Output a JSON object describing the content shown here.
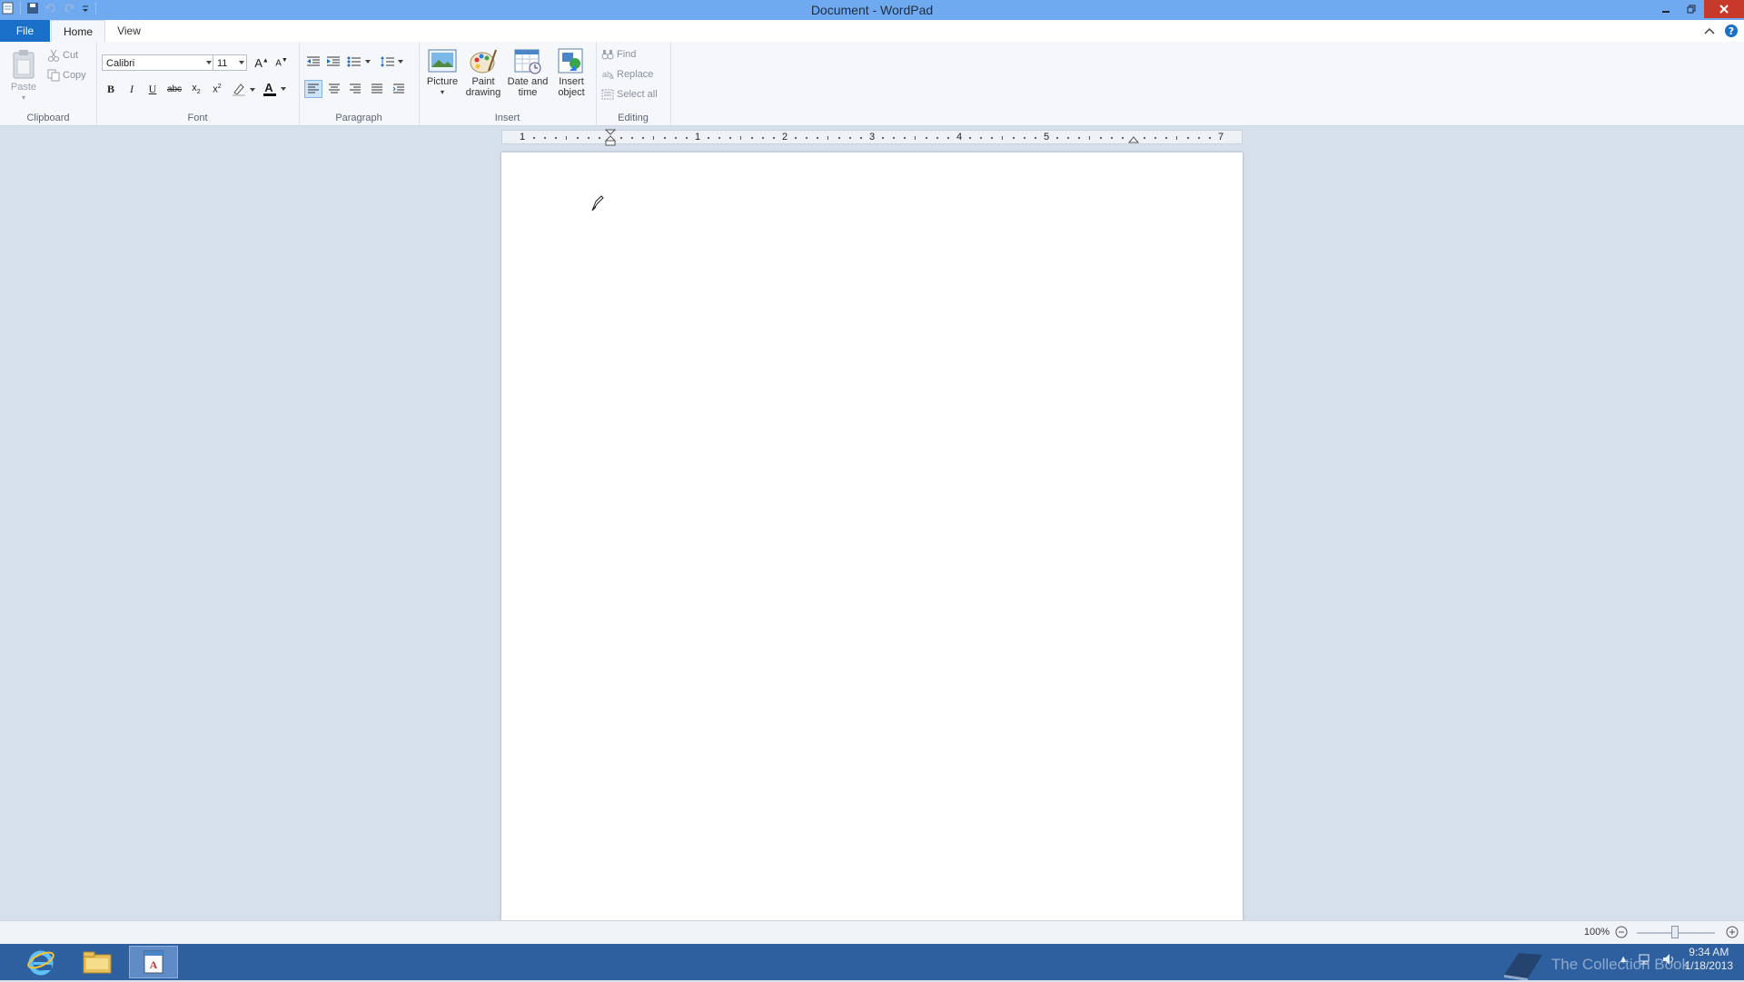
{
  "window": {
    "title": "Document - WordPad"
  },
  "ribbon_tabs": {
    "file": "File",
    "home": "Home",
    "view": "View"
  },
  "clipboard": {
    "paste": "Paste",
    "cut": "Cut",
    "copy": "Copy",
    "group_label": "Clipboard"
  },
  "font": {
    "family": "Calibri",
    "size": "11",
    "group_label": "Font"
  },
  "paragraph": {
    "group_label": "Paragraph"
  },
  "insert": {
    "picture": "Picture",
    "paint_drawing_1": "Paint",
    "paint_drawing_2": "drawing",
    "date_time_1": "Date and",
    "date_time_2": "time",
    "insert_object_1": "Insert",
    "insert_object_2": "object",
    "group_label": "Insert"
  },
  "editing": {
    "find": "Find",
    "replace": "Replace",
    "select_all": "Select all",
    "group_label": "Editing"
  },
  "ruler": {
    "numbers": [
      "1",
      "1",
      "2",
      "3",
      "4",
      "5",
      "7"
    ]
  },
  "status": {
    "zoom": "100%"
  },
  "taskbar": {
    "time": "9:34 AM",
    "date": "1/18/2013",
    "watermark": "The Collection Book"
  },
  "colors": {
    "title_bar": "#6faaf0",
    "file_tab": "#1a6fc9",
    "taskbar": "#2e5f9e",
    "close_button": "#c7392b"
  }
}
